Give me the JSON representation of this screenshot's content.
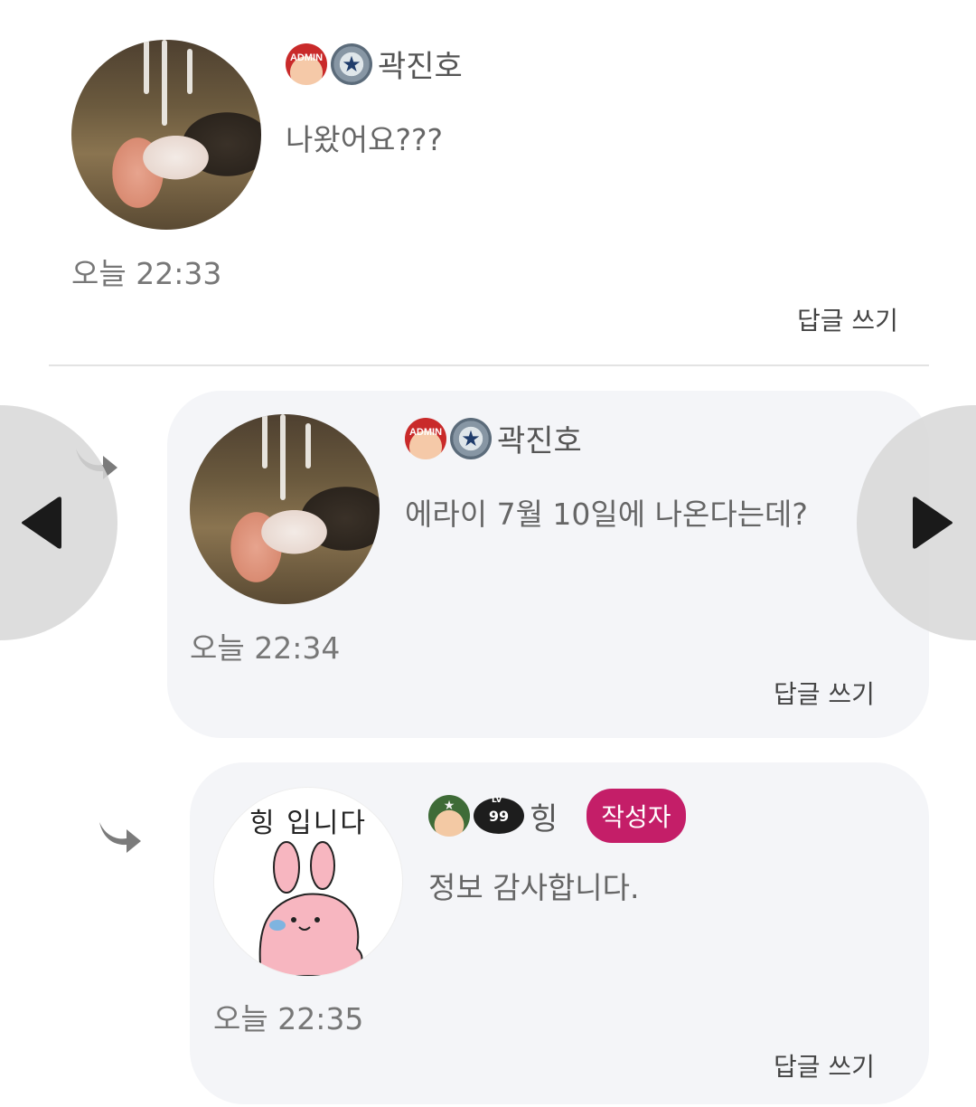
{
  "comments": [
    {
      "user": {
        "nickname": "곽진호",
        "badges": [
          "admin-badge",
          "star-rank-badge"
        ]
      },
      "message": "나왔어요???",
      "time": "오늘 22:33",
      "reply_label": "답글 쓰기"
    },
    {
      "is_reply": true,
      "user": {
        "nickname": "곽진호",
        "badges": [
          "admin-badge",
          "star-rank-badge"
        ]
      },
      "message": "에라이 7월 10일에 나온다는데?",
      "time": "오늘 22:34",
      "reply_label": "답글 쓰기"
    },
    {
      "is_reply": true,
      "user": {
        "nickname": "힝",
        "badges": [
          "soldier-badge",
          "level-badge"
        ],
        "level": "99",
        "level_prefix": "LV",
        "author_tag": "작성자"
      },
      "message": "정보 감사합니다.",
      "time": "오늘 22:35",
      "reply_label": "답글 쓰기",
      "avatar_text": "힝 입니다"
    }
  ],
  "badge_text": {
    "admin": "ADMIN"
  },
  "colors": {
    "author_tag_bg": "#c41e68",
    "card_bg": "#f4f5f8",
    "divider": "#e3e3e3"
  },
  "nav": {
    "prev_icon": "left-triangle-icon",
    "next_icon": "right-triangle-icon"
  }
}
